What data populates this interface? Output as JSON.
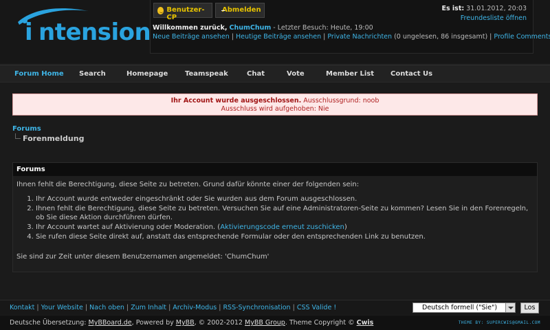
{
  "logo": {
    "text": "ntension",
    "letter": "i"
  },
  "userpanel": {
    "ucp_label": "Benutzer-CP",
    "logout_label": "Abmelden",
    "welcome_prefix": "Willkommen zurück,",
    "username": "ChumChum",
    "last_visit": " - Letzter Besuch: Heute, 19:00",
    "links": [
      "Neue Beiträge ansehen",
      "Heutige Beiträge ansehen",
      "Private Nachrichten"
    ],
    "pm_info": " (0 ungelesen, 86 insgesamt) | ",
    "profile_link": "Profile Comments"
  },
  "datebox": {
    "label": "Es ist:",
    "value": " 31.01.2012, 20:03",
    "friends_link": "Freundesliste öffnen"
  },
  "nav": {
    "items": [
      "Forum Home",
      "Search",
      "Homepage",
      "Teamspeak",
      "Chat",
      "Vote",
      "Member List",
      "Contact Us"
    ]
  },
  "error": {
    "title": "Ihr Account wurde ausgeschlossen.",
    "reason": " Ausschlussgrund: noob",
    "lifted": "Ausschluss wird aufgehoben: Nie"
  },
  "breadcrumb": {
    "root": "Forums",
    "current": "Forenmeldung"
  },
  "box": {
    "title": "Forums",
    "intro": "Ihnen fehlt die Berechtigung, diese Seite zu betreten. Grund dafür könnte einer der folgenden sein:",
    "reasons": [
      "Ihr Account wurde entweder eingeschränkt oder Sie wurden aus dem Forum ausgeschlossen.",
      "Ihnen fehlt die Berechtigung, diese Seite zu betreten. Versuchen Sie auf eine Administratoren-Seite zu kommen? Lesen Sie in den Forenregeln, ob Sie diese Aktion durchführen dürfen.",
      "Ihr Account wartet auf Aktivierung oder Moderation. (",
      "Sie rufen diese Seite direkt auf, anstatt das entsprechende Formular oder den entsprechenden Link zu benutzen."
    ],
    "activation_link": "Aktivierungscode erneut zuschicken",
    "activation_close": ")",
    "logged_as": "Sie sind zur Zeit unter diesem Benutzernamen angemeldet: 'ChumChum'"
  },
  "footer": {
    "links": [
      "Kontakt",
      "Your Website",
      "Nach oben",
      "Zum Inhalt",
      "Archiv-Modus",
      "RSS-Synchronisation",
      "CSS Valide !"
    ],
    "language": "Deutsch formell (\"Sie\")",
    "go_label": "Los"
  },
  "bottom": {
    "translation_prefix": "Deutsche Übersetzung: ",
    "translation_site": "MyBBoard.de",
    "powered_prefix": ", Powered by ",
    "mybb": "MyBB",
    "copyright_mid": ", © 2002-2012 ",
    "mybb_group": "MyBB Group",
    "theme_prefix": ". Theme Copyright © ",
    "theme_author": "Cwis",
    "theme_by": "THEME BY: SUPERCWIS@GMAIL.COM"
  },
  "colors": {
    "accent": "#3fb6e8",
    "logo": "#2aa3df",
    "error_bg": "#fde8e8"
  }
}
